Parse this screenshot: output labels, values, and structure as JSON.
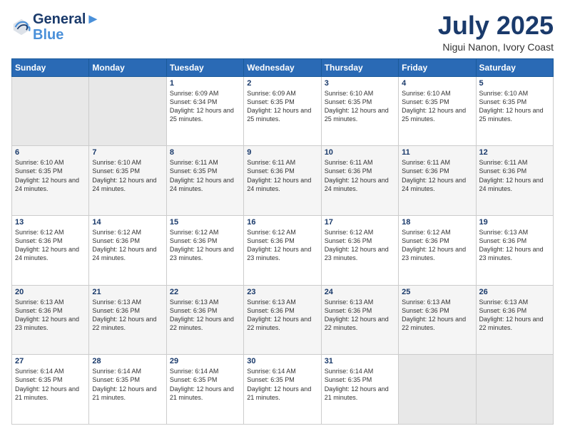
{
  "header": {
    "logo_line1": "General",
    "logo_line2": "Blue",
    "month": "July 2025",
    "location": "Nigui Nanon, Ivory Coast"
  },
  "days_of_week": [
    "Sunday",
    "Monday",
    "Tuesday",
    "Wednesday",
    "Thursday",
    "Friday",
    "Saturday"
  ],
  "weeks": [
    [
      {
        "day": "",
        "info": ""
      },
      {
        "day": "",
        "info": ""
      },
      {
        "day": "1",
        "info": "Sunrise: 6:09 AM\nSunset: 6:34 PM\nDaylight: 12 hours and 25 minutes."
      },
      {
        "day": "2",
        "info": "Sunrise: 6:09 AM\nSunset: 6:35 PM\nDaylight: 12 hours and 25 minutes."
      },
      {
        "day": "3",
        "info": "Sunrise: 6:10 AM\nSunset: 6:35 PM\nDaylight: 12 hours and 25 minutes."
      },
      {
        "day": "4",
        "info": "Sunrise: 6:10 AM\nSunset: 6:35 PM\nDaylight: 12 hours and 25 minutes."
      },
      {
        "day": "5",
        "info": "Sunrise: 6:10 AM\nSunset: 6:35 PM\nDaylight: 12 hours and 25 minutes."
      }
    ],
    [
      {
        "day": "6",
        "info": "Sunrise: 6:10 AM\nSunset: 6:35 PM\nDaylight: 12 hours and 24 minutes."
      },
      {
        "day": "7",
        "info": "Sunrise: 6:10 AM\nSunset: 6:35 PM\nDaylight: 12 hours and 24 minutes."
      },
      {
        "day": "8",
        "info": "Sunrise: 6:11 AM\nSunset: 6:35 PM\nDaylight: 12 hours and 24 minutes."
      },
      {
        "day": "9",
        "info": "Sunrise: 6:11 AM\nSunset: 6:36 PM\nDaylight: 12 hours and 24 minutes."
      },
      {
        "day": "10",
        "info": "Sunrise: 6:11 AM\nSunset: 6:36 PM\nDaylight: 12 hours and 24 minutes."
      },
      {
        "day": "11",
        "info": "Sunrise: 6:11 AM\nSunset: 6:36 PM\nDaylight: 12 hours and 24 minutes."
      },
      {
        "day": "12",
        "info": "Sunrise: 6:11 AM\nSunset: 6:36 PM\nDaylight: 12 hours and 24 minutes."
      }
    ],
    [
      {
        "day": "13",
        "info": "Sunrise: 6:12 AM\nSunset: 6:36 PM\nDaylight: 12 hours and 24 minutes."
      },
      {
        "day": "14",
        "info": "Sunrise: 6:12 AM\nSunset: 6:36 PM\nDaylight: 12 hours and 24 minutes."
      },
      {
        "day": "15",
        "info": "Sunrise: 6:12 AM\nSunset: 6:36 PM\nDaylight: 12 hours and 23 minutes."
      },
      {
        "day": "16",
        "info": "Sunrise: 6:12 AM\nSunset: 6:36 PM\nDaylight: 12 hours and 23 minutes."
      },
      {
        "day": "17",
        "info": "Sunrise: 6:12 AM\nSunset: 6:36 PM\nDaylight: 12 hours and 23 minutes."
      },
      {
        "day": "18",
        "info": "Sunrise: 6:12 AM\nSunset: 6:36 PM\nDaylight: 12 hours and 23 minutes."
      },
      {
        "day": "19",
        "info": "Sunrise: 6:13 AM\nSunset: 6:36 PM\nDaylight: 12 hours and 23 minutes."
      }
    ],
    [
      {
        "day": "20",
        "info": "Sunrise: 6:13 AM\nSunset: 6:36 PM\nDaylight: 12 hours and 23 minutes."
      },
      {
        "day": "21",
        "info": "Sunrise: 6:13 AM\nSunset: 6:36 PM\nDaylight: 12 hours and 22 minutes."
      },
      {
        "day": "22",
        "info": "Sunrise: 6:13 AM\nSunset: 6:36 PM\nDaylight: 12 hours and 22 minutes."
      },
      {
        "day": "23",
        "info": "Sunrise: 6:13 AM\nSunset: 6:36 PM\nDaylight: 12 hours and 22 minutes."
      },
      {
        "day": "24",
        "info": "Sunrise: 6:13 AM\nSunset: 6:36 PM\nDaylight: 12 hours and 22 minutes."
      },
      {
        "day": "25",
        "info": "Sunrise: 6:13 AM\nSunset: 6:36 PM\nDaylight: 12 hours and 22 minutes."
      },
      {
        "day": "26",
        "info": "Sunrise: 6:13 AM\nSunset: 6:36 PM\nDaylight: 12 hours and 22 minutes."
      }
    ],
    [
      {
        "day": "27",
        "info": "Sunrise: 6:14 AM\nSunset: 6:35 PM\nDaylight: 12 hours and 21 minutes."
      },
      {
        "day": "28",
        "info": "Sunrise: 6:14 AM\nSunset: 6:35 PM\nDaylight: 12 hours and 21 minutes."
      },
      {
        "day": "29",
        "info": "Sunrise: 6:14 AM\nSunset: 6:35 PM\nDaylight: 12 hours and 21 minutes."
      },
      {
        "day": "30",
        "info": "Sunrise: 6:14 AM\nSunset: 6:35 PM\nDaylight: 12 hours and 21 minutes."
      },
      {
        "day": "31",
        "info": "Sunrise: 6:14 AM\nSunset: 6:35 PM\nDaylight: 12 hours and 21 minutes."
      },
      {
        "day": "",
        "info": ""
      },
      {
        "day": "",
        "info": ""
      }
    ]
  ]
}
